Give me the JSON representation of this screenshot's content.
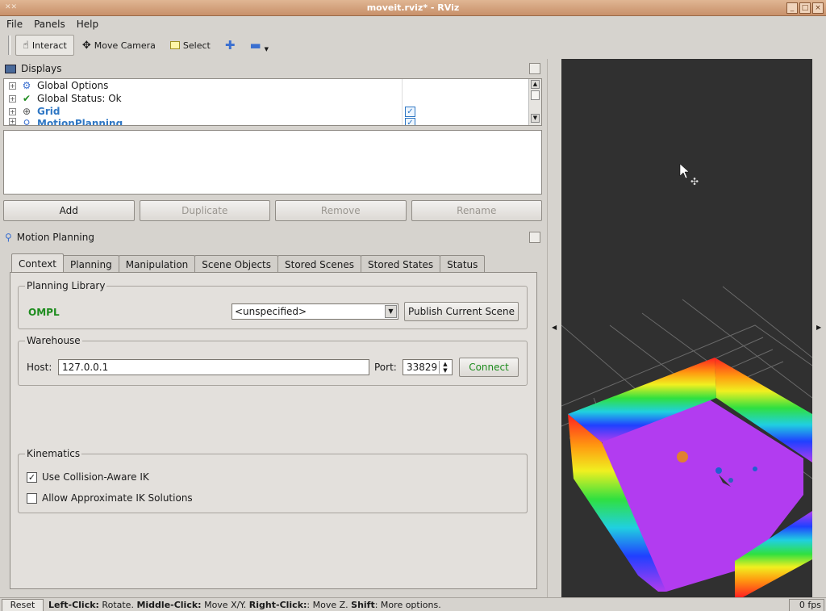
{
  "window": {
    "title": "moveit.rviz* - RViz"
  },
  "menu": {
    "file": "File",
    "panels": "Panels",
    "help": "Help"
  },
  "toolbar": {
    "interact": "Interact",
    "move_camera": "Move Camera",
    "select": "Select"
  },
  "displays": {
    "title": "Displays",
    "items": [
      {
        "label": "Global Options",
        "icon": "gear-icon",
        "checked": null
      },
      {
        "label": "Global Status: Ok",
        "icon": "checkmark-icon",
        "checked": null
      },
      {
        "label": "Grid",
        "icon": "grid-icon",
        "checked": true
      },
      {
        "label": "MotionPlanning",
        "icon": "robot-arm-icon",
        "checked": true
      }
    ],
    "buttons": {
      "add": "Add",
      "duplicate": "Duplicate",
      "remove": "Remove",
      "rename": "Rename"
    }
  },
  "motion_planning": {
    "title": "Motion Planning",
    "tabs": [
      "Context",
      "Planning",
      "Manipulation",
      "Scene Objects",
      "Stored Scenes",
      "Stored States",
      "Status"
    ],
    "active_tab": "Context",
    "planning_library": {
      "title": "Planning Library",
      "library": "OMPL",
      "planner_selected": "<unspecified>",
      "publish_button": "Publish Current Scene"
    },
    "warehouse": {
      "title": "Warehouse",
      "host_label": "Host:",
      "host_value": "127.0.0.1",
      "port_label": "Port:",
      "port_value": "33829",
      "connect_button": "Connect"
    },
    "kinematics": {
      "title": "Kinematics",
      "collision_aware_ik": {
        "label": "Use Collision-Aware IK",
        "checked": true
      },
      "approx_ik": {
        "label": "Allow Approximate IK Solutions",
        "checked": false
      }
    }
  },
  "statusbar": {
    "reset": "Reset",
    "hint_left_click_key": "Left-Click:",
    "hint_left_click": " Rotate. ",
    "hint_middle_click_key": "Middle-Click:",
    "hint_middle_click": " Move X/Y. ",
    "hint_right_click_key": "Right-Click:",
    "hint_right_click": ": Move Z. ",
    "hint_shift_key": "Shift",
    "hint_shift": ": More options.",
    "fps": "0 fps"
  },
  "colors": {
    "titlebar": "#d9a57f",
    "ompl_green": "#1e8c1e",
    "display_blue": "#2f77c4",
    "viewport_bg": "#303030",
    "pointcloud_floor": "#b23cf0"
  }
}
